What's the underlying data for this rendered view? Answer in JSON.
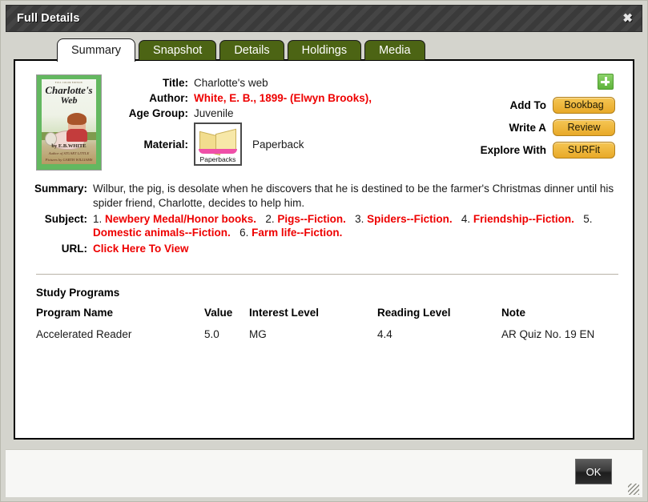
{
  "window": {
    "title": "Full Details",
    "close_label": "✖"
  },
  "tabs": [
    {
      "label": "Summary",
      "active": true
    },
    {
      "label": "Snapshot",
      "active": false
    },
    {
      "label": "Details",
      "active": false
    },
    {
      "label": "Holdings",
      "active": false
    },
    {
      "label": "Media",
      "active": false
    }
  ],
  "cover": {
    "edition": "FULL COLOR EDITION",
    "title_line1": "Charlotte's",
    "title_line2": "Web",
    "byline": "by E.B.WHITE",
    "sub1": "Author of STUART LITTLE",
    "sub2": "Pictures by GARTH WILLIAMS"
  },
  "fields": {
    "title_label": "Title:",
    "title_value": "Charlotte's web",
    "author_label": "Author:",
    "author_value": "White, E. B., 1899- (Elwyn Brooks),",
    "age_group_label": "Age Group:",
    "age_group_value": "Juvenile",
    "material_label": "Material:",
    "material_icon_caption": "Paperbacks",
    "material_value": "Paperback"
  },
  "actions": {
    "add_icon": "plus-icon",
    "rows": [
      {
        "label": "Add To",
        "button": "Bookbag"
      },
      {
        "label": "Write A",
        "button": "Review"
      },
      {
        "label": "Explore With",
        "button": "SURFit"
      }
    ]
  },
  "summary": {
    "label": "Summary:",
    "text": "Wilbur, the pig, is desolate when he discovers that he is destined to be the farmer's Christmas dinner until his spider friend, Charlotte, decides to help him."
  },
  "subject": {
    "label": "Subject:",
    "items": [
      {
        "num": "1.",
        "term": "Newbery Medal/Honor books."
      },
      {
        "num": "2.",
        "term": "Pigs--Fiction."
      },
      {
        "num": "3.",
        "term": "Spiders--Fiction."
      },
      {
        "num": "4.",
        "term": "Friendship--Fiction."
      },
      {
        "num": "5.",
        "term": "Domestic animals--Fiction."
      },
      {
        "num": "6.",
        "term": "Farm life--Fiction."
      }
    ]
  },
  "url": {
    "label": "URL:",
    "link_text": "Click Here To View"
  },
  "study_programs": {
    "section_title": "Study Programs",
    "columns": [
      "Program Name",
      "Value",
      "Interest Level",
      "Reading Level",
      "Note"
    ],
    "rows": [
      {
        "program_name": "Accelerated Reader",
        "value": "5.0",
        "interest_level": "MG",
        "reading_level": "4.4",
        "note": "AR Quiz No. 19 EN"
      }
    ]
  },
  "footer": {
    "ok_label": "OK"
  },
  "colors": {
    "tab_active_bg": "#ffffff",
    "tab_inactive_bg": "#4c6414",
    "accent_red": "#ee0000",
    "button_amber": "#e8a928",
    "titlebar_dark": "#3a3a3a",
    "panel_bg": "#ffffff",
    "window_bg": "#d4d4cd"
  }
}
